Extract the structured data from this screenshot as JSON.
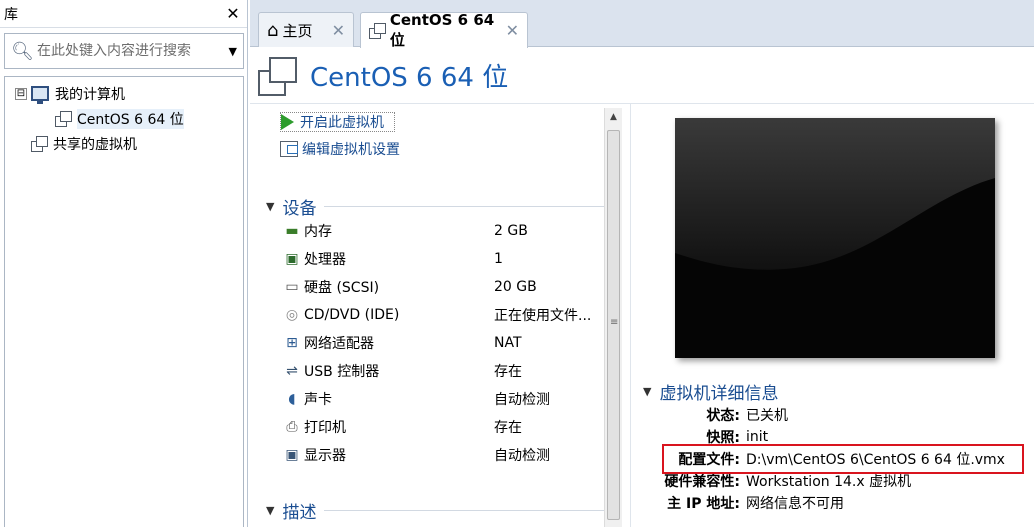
{
  "library": {
    "title": "库",
    "close": "✕",
    "search_placeholder": "在此处键入内容进行搜索",
    "tree": [
      {
        "label": "我的计算机",
        "toggle": "⊟"
      },
      {
        "label": "CentOS 6 64 位"
      },
      {
        "label": "共享的虚拟机"
      }
    ]
  },
  "tabs": [
    {
      "label": "主页",
      "close": "✕"
    },
    {
      "label": "CentOS 6 64 位",
      "close": "✕"
    }
  ],
  "vm": {
    "title": "CentOS 6 64 位",
    "actions": {
      "start": "开启此虚拟机",
      "edit": "编辑虚拟机设置"
    }
  },
  "devices": {
    "header": "设备",
    "items": [
      {
        "name": "内存",
        "value": "2 GB",
        "icon": "memory-icon"
      },
      {
        "name": "处理器",
        "value": "1",
        "icon": "cpu-icon"
      },
      {
        "name": "硬盘 (SCSI)",
        "value": "20 GB",
        "icon": "hdd-icon"
      },
      {
        "name": "CD/DVD (IDE)",
        "value": "正在使用文件...",
        "icon": "cd-icon"
      },
      {
        "name": "网络适配器",
        "value": "NAT",
        "icon": "network-icon"
      },
      {
        "name": "USB 控制器",
        "value": "存在",
        "icon": "usb-icon"
      },
      {
        "name": "声卡",
        "value": "自动检测",
        "icon": "speaker-icon"
      },
      {
        "name": "打印机",
        "value": "存在",
        "icon": "printer-icon"
      },
      {
        "name": "显示器",
        "value": "自动检测",
        "icon": "monitor-icon"
      }
    ]
  },
  "description": {
    "header": "描述"
  },
  "details": {
    "header": "虚拟机详细信息",
    "rows": [
      {
        "key": "状态:",
        "value": "已关机"
      },
      {
        "key": "快照:",
        "value": "init"
      },
      {
        "key": "配置文件:",
        "value": "D:\\vm\\CentOS 6\\CentOS 6 64 位.vmx"
      },
      {
        "key": "硬件兼容性:",
        "value": "Workstation 14.x 虚拟机"
      },
      {
        "key": "主 IP 地址:",
        "value": "网络信息不可用"
      }
    ]
  },
  "colors": {
    "accent": "#1a5fb4",
    "highlight": "#d9141e"
  }
}
